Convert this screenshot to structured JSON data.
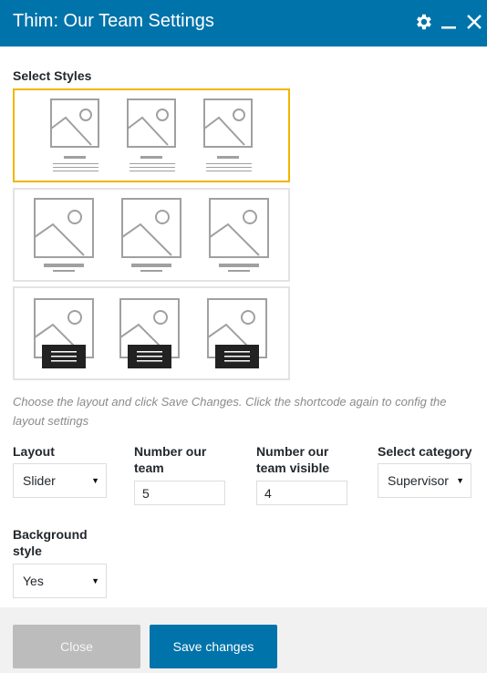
{
  "dialog": {
    "title": "Thim: Our Team Settings"
  },
  "header_icons": [
    "gear-icon",
    "minimize-icon",
    "close-icon"
  ],
  "styles_section": {
    "label": "Select Styles",
    "selected_index": 0,
    "options": [
      "style-1",
      "style-2",
      "style-3"
    ]
  },
  "hint": "Choose the layout and click Save Changes. Click the shortcode again to config the layout settings",
  "fields": {
    "layout": {
      "label": "Layout",
      "value": "Slider"
    },
    "number_team": {
      "label": "Number our team",
      "value": "5"
    },
    "number_visible": {
      "label": "Number our team visible",
      "value": "4"
    },
    "category": {
      "label": "Select category",
      "value": "Supervisor"
    },
    "background": {
      "label": "Background style",
      "value": "Yes"
    }
  },
  "buttons": {
    "close": "Close",
    "save": "Save changes"
  },
  "colors": {
    "header": "#0073aa",
    "selected_border": "#f4b400",
    "save_button": "#0073aa",
    "close_button": "#bcbcbc"
  }
}
